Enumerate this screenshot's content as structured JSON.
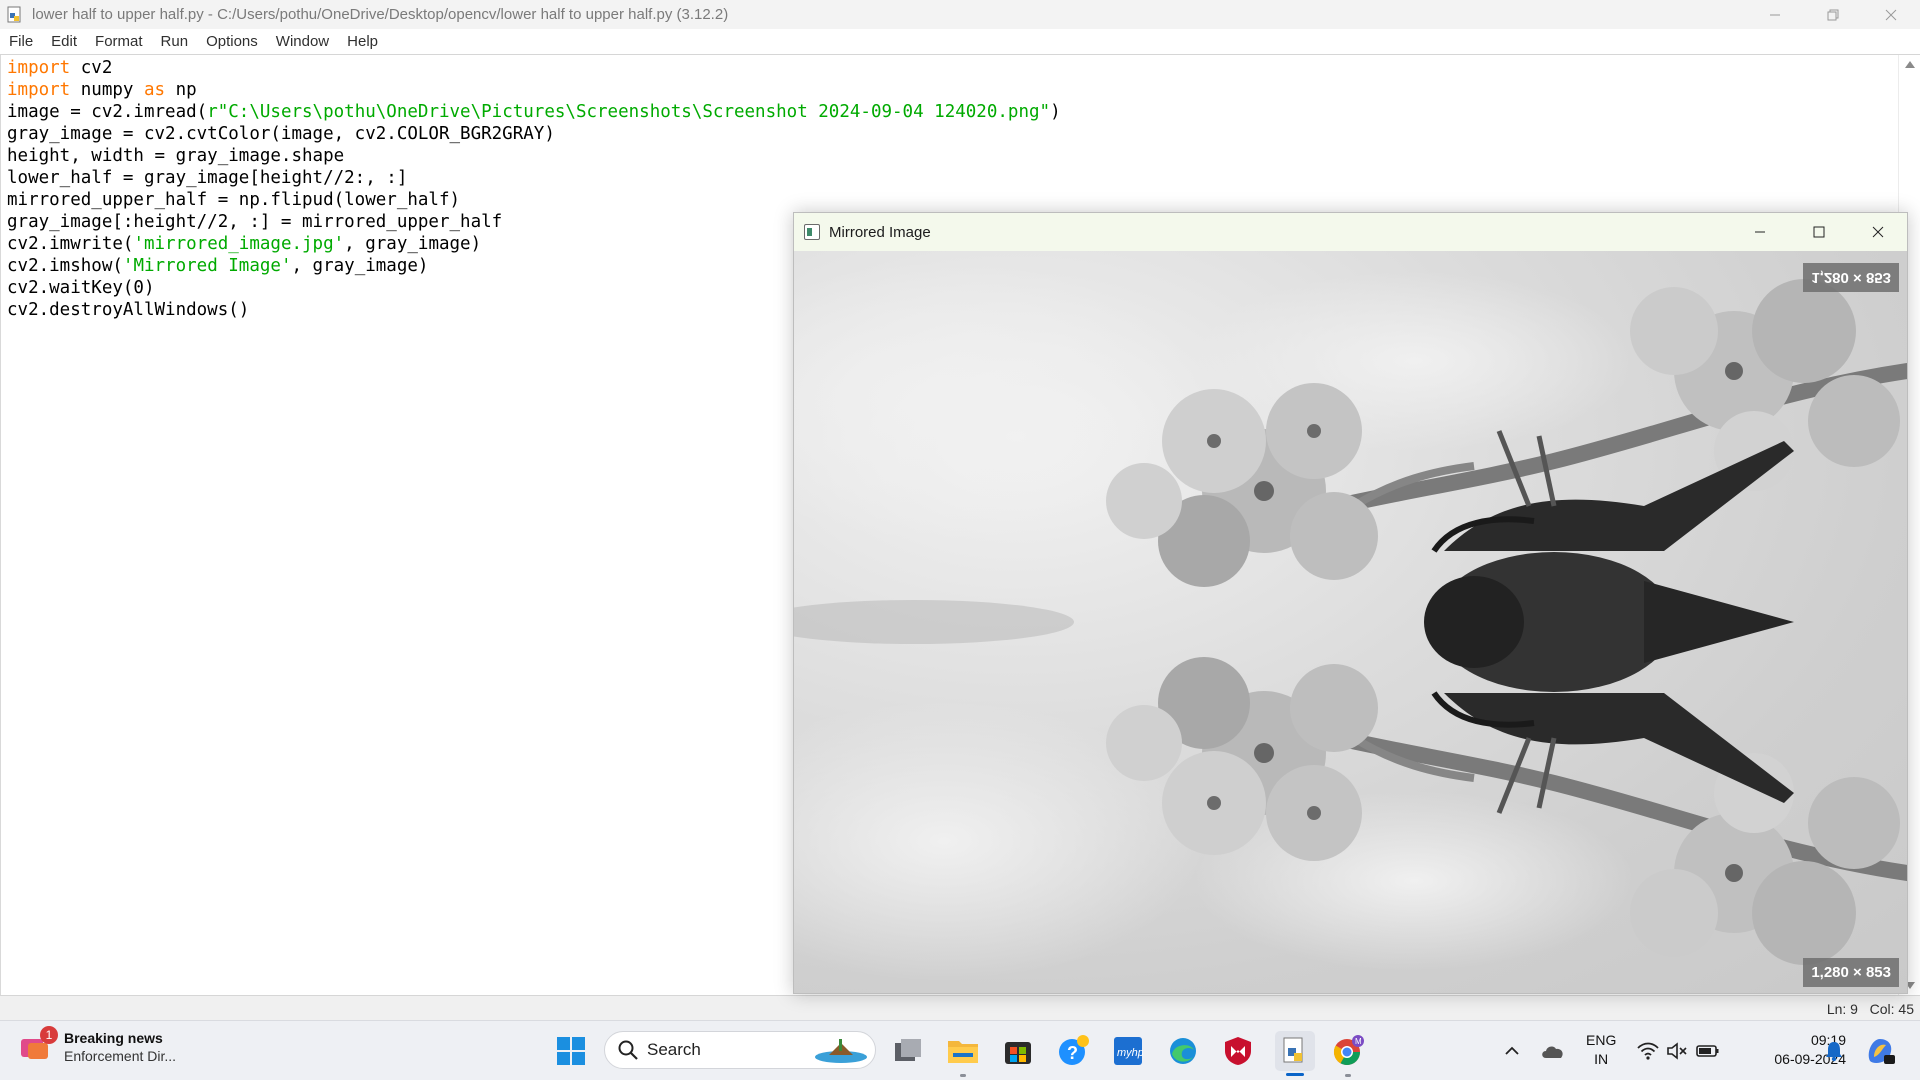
{
  "idle_window": {
    "title": "lower half to upper half.py - C:/Users/pothu/OneDrive/Desktop/opencv/lower half to upper half.py (3.12.2)",
    "menu": [
      "File",
      "Edit",
      "Format",
      "Run",
      "Options",
      "Window",
      "Help"
    ],
    "status": {
      "line": "Ln: 9",
      "col": "Col: 45"
    }
  },
  "code": {
    "l1_kw": "import",
    "l1_rest": " cv2",
    "l2_kw": "import",
    "l2_mid": " numpy ",
    "l2_kw2": "as",
    "l2_rest": " np",
    "l3_a": "image = cv2.imread(",
    "l3_str": "r\"C:\\Users\\pothu\\OneDrive\\Pictures\\Screenshots\\Screenshot 2024-09-04 124020.png\"",
    "l3_b": ")",
    "l4": "gray_image = cv2.cvtColor(image, cv2.COLOR_BGR2GRAY)",
    "l5": "height, width = gray_image.shape",
    "l6": "lower_half = gray_image[height//2:, :]",
    "l7": "mirrored_upper_half = np.flipud(lower_half)",
    "l8": "gray_image[:height//2, :] = mirrored_upper_half",
    "l9_a": "cv2.imwrite(",
    "l9_str": "'mirrored_image.jpg'",
    "l9_b": ", gray_image)",
    "l10_a": "cv2.imshow(",
    "l10_str": "'Mirrored Image'",
    "l10_b": ", gray_image)",
    "l11": "cv2.waitKey(0)",
    "l12": "cv2.destroyAllWindows()"
  },
  "image_window": {
    "title": "Mirrored Image",
    "dim_top": "1,280 × 853",
    "dim_bottom": "1,280 × 853"
  },
  "taskbar": {
    "news_title": "Breaking news",
    "news_subtitle": "Enforcement Dir...",
    "news_badge": "1",
    "search_label": "Search",
    "lang_line1": "ENG",
    "lang_line2": "IN",
    "time": "09:19",
    "date": "06-09-2024"
  },
  "colors": {
    "keyword": "#ff7700",
    "string": "#00aa00",
    "accent": "#0a64c8"
  }
}
